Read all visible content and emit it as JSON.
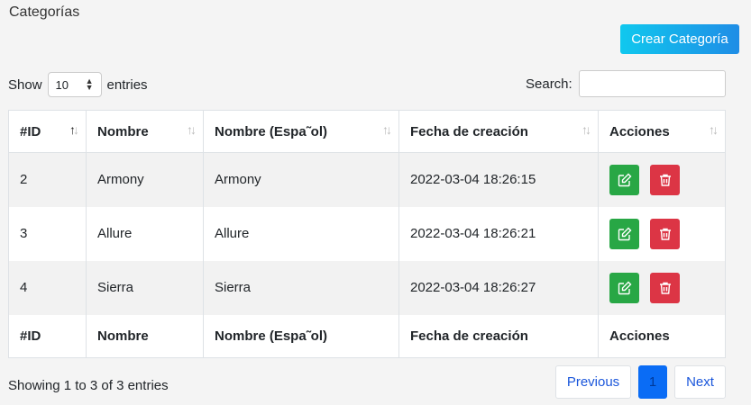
{
  "page": {
    "title": "Categorías"
  },
  "toolbar": {
    "create_label": "Crear Categoría"
  },
  "length": {
    "show_label": "Show",
    "value": "10",
    "entries_label": "entries"
  },
  "search": {
    "label": "Search:",
    "value": ""
  },
  "table": {
    "columns": [
      "#ID",
      "Nombre",
      "Nombre (Espa˜ol)",
      "Fecha de creación",
      "Acciones"
    ],
    "rows": [
      {
        "id": "2",
        "name": "Armony",
        "name_es": "Armony",
        "created": "2022-03-04 18:26:15"
      },
      {
        "id": "3",
        "name": "Allure",
        "name_es": "Allure",
        "created": "2022-03-04 18:26:21"
      },
      {
        "id": "4",
        "name": "Sierra",
        "name_es": "Sierra",
        "created": "2022-03-04 18:26:27"
      }
    ]
  },
  "footer": {
    "info": "Showing 1 to 3 of 3 entries",
    "previous": "Previous",
    "current_page": "1",
    "next": "Next"
  },
  "colors": {
    "edit": "#28a745",
    "delete": "#dc3545",
    "accent": "#0a6cf5"
  },
  "icons": {
    "edit": "edit-icon",
    "delete": "trash-icon",
    "sort": "sort-arrows-icon"
  }
}
